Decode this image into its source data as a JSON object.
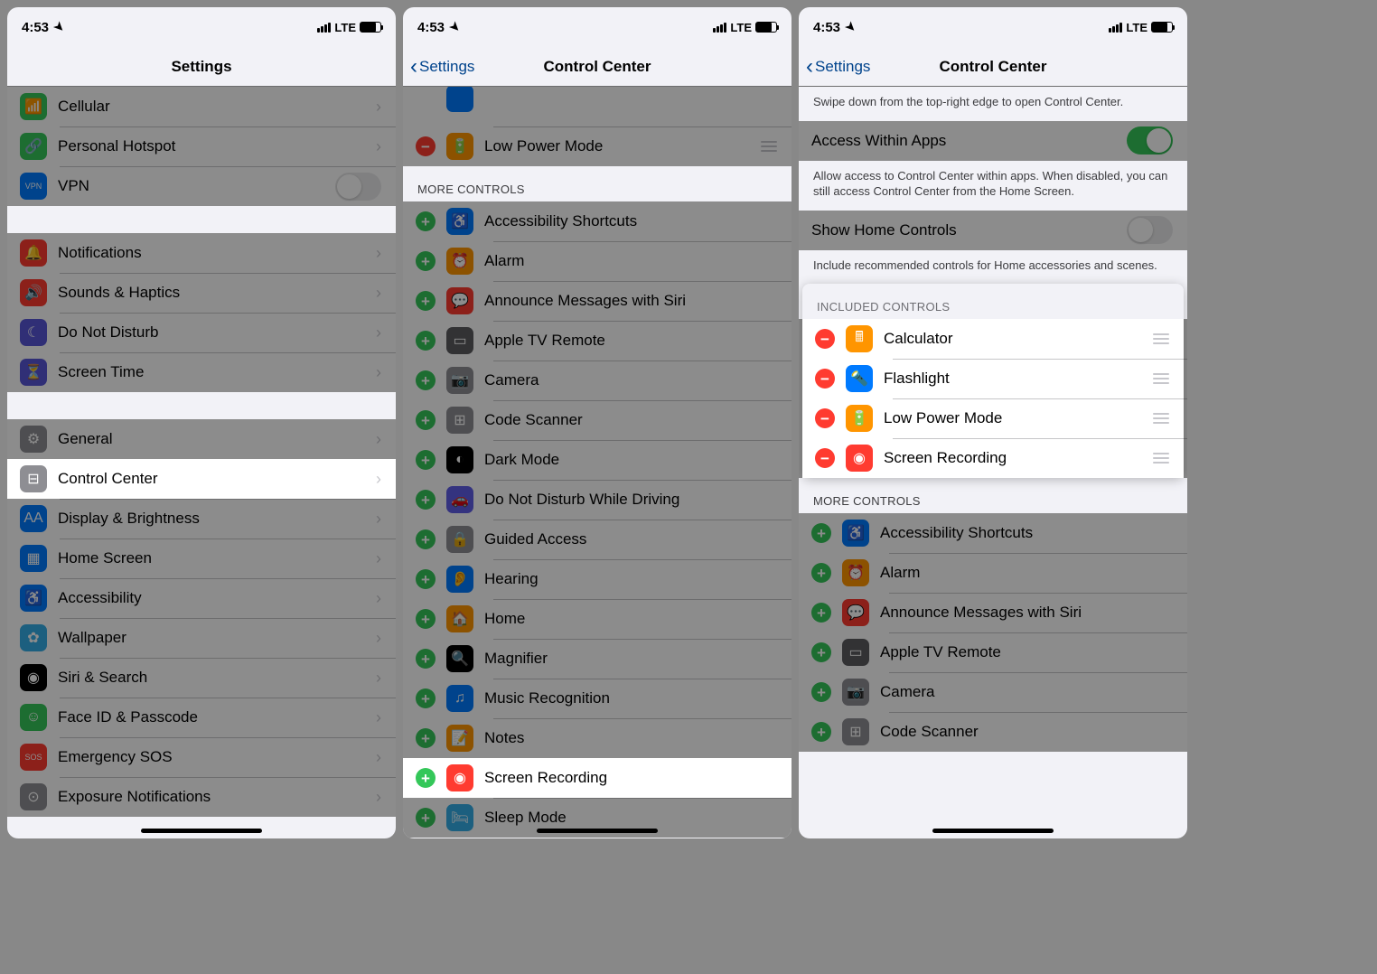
{
  "status": {
    "time": "4:53",
    "carrier": "LTE"
  },
  "screen1": {
    "title": "Settings",
    "rows_top": [
      {
        "label": "Cellular",
        "icon_bg": "bg-green",
        "icon": "📶"
      },
      {
        "label": "Personal Hotspot",
        "icon_bg": "bg-green",
        "icon": "🔗"
      },
      {
        "label": "VPN",
        "icon_bg": "bg-blue",
        "icon": "VPN",
        "toggle": true
      }
    ],
    "rows_mid": [
      {
        "label": "Notifications",
        "icon_bg": "bg-red",
        "icon": "🔔"
      },
      {
        "label": "Sounds & Haptics",
        "icon_bg": "bg-red",
        "icon": "🔊"
      },
      {
        "label": "Do Not Disturb",
        "icon_bg": "bg-purple",
        "icon": "☾"
      },
      {
        "label": "Screen Time",
        "icon_bg": "bg-purple",
        "icon": "⏳"
      }
    ],
    "rows_bot": [
      {
        "label": "General",
        "icon_bg": "bg-gray",
        "icon": "⚙"
      },
      {
        "label": "Control Center",
        "icon_bg": "bg-gray",
        "icon": "⊟",
        "hl": true
      },
      {
        "label": "Display & Brightness",
        "icon_bg": "bg-blue",
        "icon": "AA"
      },
      {
        "label": "Home Screen",
        "icon_bg": "bg-blue",
        "icon": "▦"
      },
      {
        "label": "Accessibility",
        "icon_bg": "bg-blue",
        "icon": "♿"
      },
      {
        "label": "Wallpaper",
        "icon_bg": "bg-teal",
        "icon": "✿"
      },
      {
        "label": "Siri & Search",
        "icon_bg": "bg-black",
        "icon": "◉"
      },
      {
        "label": "Face ID & Passcode",
        "icon_bg": "bg-green",
        "icon": "☺"
      },
      {
        "label": "Emergency SOS",
        "icon_bg": "bg-red",
        "icon": "SOS"
      },
      {
        "label": "Exposure Notifications",
        "icon_bg": "bg-gray",
        "icon": "⊙"
      }
    ]
  },
  "screen2": {
    "back": "Settings",
    "title": "Control Center",
    "included_tail": [
      {
        "label": "Low Power Mode",
        "icon_bg": "bg-orange",
        "icon": "🔋",
        "btn": "remove",
        "drag": true
      }
    ],
    "more_header": "MORE CONTROLS",
    "more": [
      {
        "label": "Accessibility Shortcuts",
        "icon_bg": "bg-blue",
        "icon": "♿"
      },
      {
        "label": "Alarm",
        "icon_bg": "bg-orange",
        "icon": "⏰"
      },
      {
        "label": "Announce Messages with Siri",
        "icon_bg": "bg-red",
        "icon": "💬"
      },
      {
        "label": "Apple TV Remote",
        "icon_bg": "bg-darkgray",
        "icon": "▭"
      },
      {
        "label": "Camera",
        "icon_bg": "bg-gray",
        "icon": "📷"
      },
      {
        "label": "Code Scanner",
        "icon_bg": "bg-gray",
        "icon": "⊞"
      },
      {
        "label": "Dark Mode",
        "icon_bg": "bg-black",
        "icon": "◐"
      },
      {
        "label": "Do Not Disturb While Driving",
        "icon_bg": "bg-indigo",
        "icon": "🚗"
      },
      {
        "label": "Guided Access",
        "icon_bg": "bg-gray",
        "icon": "🔒"
      },
      {
        "label": "Hearing",
        "icon_bg": "bg-blue",
        "icon": "👂"
      },
      {
        "label": "Home",
        "icon_bg": "bg-orange",
        "icon": "🏠"
      },
      {
        "label": "Magnifier",
        "icon_bg": "bg-black",
        "icon": "🔍"
      },
      {
        "label": "Music Recognition",
        "icon_bg": "bg-blue",
        "icon": "♫"
      },
      {
        "label": "Notes",
        "icon_bg": "bg-orange",
        "icon": "📝"
      },
      {
        "label": "Screen Recording",
        "icon_bg": "bg-red",
        "icon": "◉",
        "hl": true
      },
      {
        "label": "Sleep Mode",
        "icon_bg": "bg-teal",
        "icon": "🛏"
      }
    ]
  },
  "screen3": {
    "back": "Settings",
    "title": "Control Center",
    "hint": "Swipe down from the top-right edge to open Control Center.",
    "access_label": "Access Within Apps",
    "access_footer": "Allow access to Control Center within apps. When disabled, you can still access Control Center from the Home Screen.",
    "home_label": "Show Home Controls",
    "home_footer": "Include recommended controls for Home accessories and scenes.",
    "included_header": "INCLUDED CONTROLS",
    "included": [
      {
        "label": "Calculator",
        "icon_bg": "bg-orange",
        "icon": "🖩"
      },
      {
        "label": "Flashlight",
        "icon_bg": "bg-blue",
        "icon": "🔦"
      },
      {
        "label": "Low Power Mode",
        "icon_bg": "bg-orange",
        "icon": "🔋"
      },
      {
        "label": "Screen Recording",
        "icon_bg": "bg-red",
        "icon": "◉"
      }
    ],
    "more_header": "MORE CONTROLS",
    "more": [
      {
        "label": "Accessibility Shortcuts",
        "icon_bg": "bg-blue",
        "icon": "♿"
      },
      {
        "label": "Alarm",
        "icon_bg": "bg-orange",
        "icon": "⏰"
      },
      {
        "label": "Announce Messages with Siri",
        "icon_bg": "bg-red",
        "icon": "💬"
      },
      {
        "label": "Apple TV Remote",
        "icon_bg": "bg-darkgray",
        "icon": "▭"
      },
      {
        "label": "Camera",
        "icon_bg": "bg-gray",
        "icon": "📷"
      },
      {
        "label": "Code Scanner",
        "icon_bg": "bg-gray",
        "icon": "⊞"
      }
    ]
  }
}
